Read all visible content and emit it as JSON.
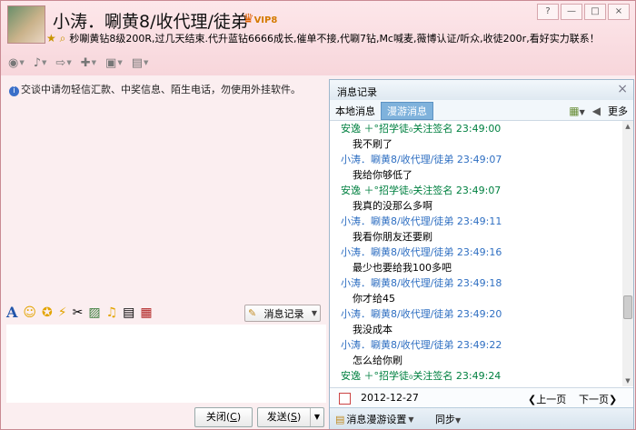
{
  "window": {
    "title": "小涛．唰黄8/收代理/徒弟",
    "vip_badge": "VIP8",
    "signature": "秒唰黄钻8级200R,过几天结束.代升蓝钻6666成长,催单不接,代唰7钻,Mc喊麦,薇博认证/听众,收徒200r,看好实力联系！",
    "controls": {
      "help": "?",
      "minimize": "—",
      "maximize": "□",
      "close": "×"
    }
  },
  "toolbar": {
    "items": [
      {
        "icon": "webcam-icon",
        "glyph": "◉"
      },
      {
        "icon": "microphone-icon",
        "glyph": "♪"
      },
      {
        "icon": "send-file-icon",
        "glyph": "⇨"
      },
      {
        "icon": "add-friend-icon",
        "glyph": "✚"
      },
      {
        "icon": "remote-desktop-icon",
        "glyph": "▣"
      },
      {
        "icon": "app-icon",
        "glyph": "▤"
      }
    ]
  },
  "notice": "交谈中请勿轻信汇款、中奖信息、陌生电话，勿使用外挂软件。",
  "format_bar": {
    "font_glyph": "A",
    "history_label": "消息记录"
  },
  "buttons": {
    "close_label": "关闭(",
    "close_key": "C",
    "close_suffix": ")",
    "send_label": "发送(",
    "send_key": "S",
    "send_suffix": ")"
  },
  "history_panel": {
    "title": "消息记录",
    "tab_local": "本地消息",
    "tab_roaming": "漫游消息",
    "more_label": "更多",
    "date": "2012-12-27",
    "prev_page": "上一页",
    "next_page": "下一页",
    "roaming_settings": "消息漫游设置",
    "sync": "同步",
    "messages": [
      {
        "sender": "安逸 ＋°招学徒₀关注签名",
        "time": "23:49:00",
        "text": "我不刷了",
        "self": false
      },
      {
        "sender": "小涛．唰黄8/收代理/徒弟",
        "time": "23:49:07",
        "text": "我给你够低了",
        "self": true
      },
      {
        "sender": "安逸 ＋°招学徒₀关注签名",
        "time": "23:49:07",
        "text": "我真的没那么多啊",
        "self": false
      },
      {
        "sender": "小涛．唰黄8/收代理/徒弟",
        "time": "23:49:11",
        "text": "我看你朋友还要刷",
        "self": true
      },
      {
        "sender": "小涛．唰黄8/收代理/徒弟",
        "time": "23:49:16",
        "text": "最少也要给我100多吧",
        "self": true
      },
      {
        "sender": "小涛．唰黄8/收代理/徒弟",
        "time": "23:49:18",
        "text": "你才给45",
        "self": true
      },
      {
        "sender": "小涛．唰黄8/收代理/徒弟",
        "time": "23:49:20",
        "text": "我没成本",
        "self": true
      },
      {
        "sender": "小涛．唰黄8/收代理/徒弟",
        "time": "23:49:22",
        "text": "怎么给你刷",
        "self": true
      },
      {
        "sender": "安逸 ＋°招学徒₀关注签名",
        "time": "23:49:24",
        "text": "",
        "self": false
      }
    ]
  }
}
